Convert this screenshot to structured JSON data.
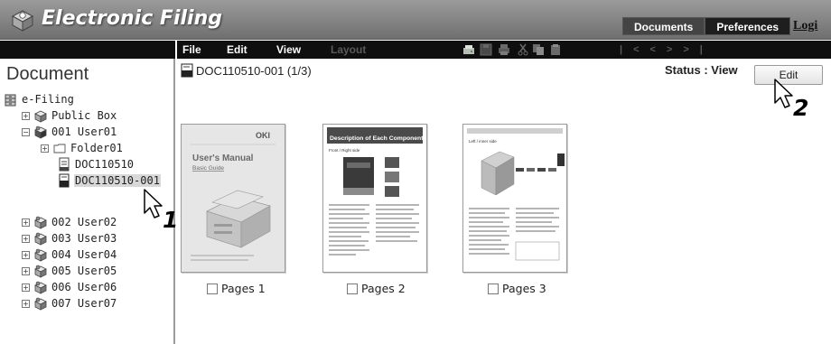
{
  "header": {
    "app_title": "Electronic Filing",
    "tabs": [
      {
        "label": "Documents",
        "active": true
      },
      {
        "label": "Preferences",
        "active": false
      }
    ],
    "login_label": "Logi"
  },
  "toolbar": {
    "menus": [
      {
        "label": "File",
        "enabled": true
      },
      {
        "label": "Edit",
        "enabled": true
      },
      {
        "label": "View",
        "enabled": true
      },
      {
        "label": "Layout",
        "enabled": false
      }
    ],
    "icons": [
      "scan-icon",
      "save-icon",
      "print-icon",
      "cut-icon",
      "copy-icon",
      "paste-icon"
    ],
    "nav_icons": [
      "first-page-icon",
      "prev-page-icon",
      "next-page-icon",
      "last-page-icon"
    ]
  },
  "left_pane": {
    "title": "Document",
    "tree": [
      {
        "label": "e-Filing",
        "icon": "cabinet-icon",
        "expander": ""
      },
      {
        "label": "Public Box",
        "icon": "box-icon",
        "expander": "+"
      },
      {
        "label": "001 User01",
        "icon": "user-box-icon",
        "expander": "−"
      },
      {
        "label": "Folder01",
        "icon": "folder-icon",
        "expander": "+"
      },
      {
        "label": "DOC110510",
        "icon": "document-icon",
        "expander": ""
      },
      {
        "label": "DOC110510-001",
        "icon": "document-dark-icon",
        "expander": "",
        "selected": true
      },
      {
        "label": "002 User02",
        "icon": "user-box-icon",
        "expander": "+"
      },
      {
        "label": "003 User03",
        "icon": "user-box-icon",
        "expander": "+"
      },
      {
        "label": "004 User04",
        "icon": "user-box-icon",
        "expander": "+"
      },
      {
        "label": "005 User05",
        "icon": "user-box-icon",
        "expander": "+"
      },
      {
        "label": "006 User06",
        "icon": "user-box-icon",
        "expander": "+"
      },
      {
        "label": "007 User07",
        "icon": "user-box-icon",
        "expander": "+"
      }
    ]
  },
  "main": {
    "doc_title": "DOC110510-001  (1/3)",
    "status": "Status : View",
    "edit_button": "Edit",
    "pages": [
      {
        "label": "Pages 1",
        "checked": false
      },
      {
        "label": "Pages 2",
        "checked": false
      },
      {
        "label": "Pages 3",
        "checked": false
      }
    ],
    "thumb1": {
      "brand": "OKI",
      "title": "User's Manual",
      "subtitle": "Basic Guide"
    },
    "thumb2": {
      "heading": "Description of Each Component",
      "sub": "Front / Right side"
    },
    "thumb3": {
      "heading": "Left / inner side"
    }
  },
  "callouts": [
    "1",
    "2"
  ],
  "colors": {
    "header_bg": "#858585",
    "toolbar_bg": "#0f0f0f",
    "selected_row": "#d8d8d8",
    "accent": "#3c6fa8"
  }
}
